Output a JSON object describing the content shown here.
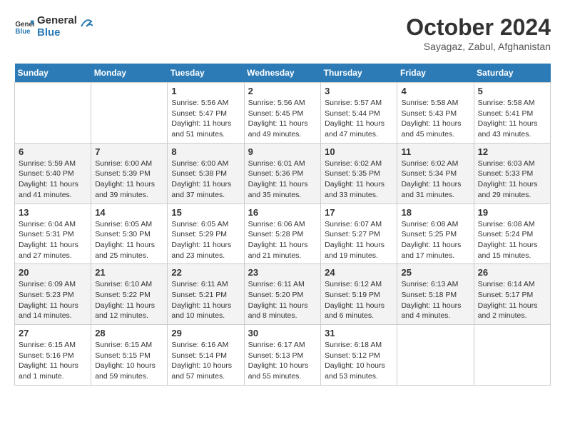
{
  "header": {
    "logo_line1": "General",
    "logo_line2": "Blue",
    "month_title": "October 2024",
    "location": "Sayagaz, Zabul, Afghanistan"
  },
  "days_of_week": [
    "Sunday",
    "Monday",
    "Tuesday",
    "Wednesday",
    "Thursday",
    "Friday",
    "Saturday"
  ],
  "weeks": [
    [
      {
        "day": "",
        "info": ""
      },
      {
        "day": "",
        "info": ""
      },
      {
        "day": "1",
        "info": "Sunrise: 5:56 AM\nSunset: 5:47 PM\nDaylight: 11 hours and 51 minutes."
      },
      {
        "day": "2",
        "info": "Sunrise: 5:56 AM\nSunset: 5:45 PM\nDaylight: 11 hours and 49 minutes."
      },
      {
        "day": "3",
        "info": "Sunrise: 5:57 AM\nSunset: 5:44 PM\nDaylight: 11 hours and 47 minutes."
      },
      {
        "day": "4",
        "info": "Sunrise: 5:58 AM\nSunset: 5:43 PM\nDaylight: 11 hours and 45 minutes."
      },
      {
        "day": "5",
        "info": "Sunrise: 5:58 AM\nSunset: 5:41 PM\nDaylight: 11 hours and 43 minutes."
      }
    ],
    [
      {
        "day": "6",
        "info": "Sunrise: 5:59 AM\nSunset: 5:40 PM\nDaylight: 11 hours and 41 minutes."
      },
      {
        "day": "7",
        "info": "Sunrise: 6:00 AM\nSunset: 5:39 PM\nDaylight: 11 hours and 39 minutes."
      },
      {
        "day": "8",
        "info": "Sunrise: 6:00 AM\nSunset: 5:38 PM\nDaylight: 11 hours and 37 minutes."
      },
      {
        "day": "9",
        "info": "Sunrise: 6:01 AM\nSunset: 5:36 PM\nDaylight: 11 hours and 35 minutes."
      },
      {
        "day": "10",
        "info": "Sunrise: 6:02 AM\nSunset: 5:35 PM\nDaylight: 11 hours and 33 minutes."
      },
      {
        "day": "11",
        "info": "Sunrise: 6:02 AM\nSunset: 5:34 PM\nDaylight: 11 hours and 31 minutes."
      },
      {
        "day": "12",
        "info": "Sunrise: 6:03 AM\nSunset: 5:33 PM\nDaylight: 11 hours and 29 minutes."
      }
    ],
    [
      {
        "day": "13",
        "info": "Sunrise: 6:04 AM\nSunset: 5:31 PM\nDaylight: 11 hours and 27 minutes."
      },
      {
        "day": "14",
        "info": "Sunrise: 6:05 AM\nSunset: 5:30 PM\nDaylight: 11 hours and 25 minutes."
      },
      {
        "day": "15",
        "info": "Sunrise: 6:05 AM\nSunset: 5:29 PM\nDaylight: 11 hours and 23 minutes."
      },
      {
        "day": "16",
        "info": "Sunrise: 6:06 AM\nSunset: 5:28 PM\nDaylight: 11 hours and 21 minutes."
      },
      {
        "day": "17",
        "info": "Sunrise: 6:07 AM\nSunset: 5:27 PM\nDaylight: 11 hours and 19 minutes."
      },
      {
        "day": "18",
        "info": "Sunrise: 6:08 AM\nSunset: 5:25 PM\nDaylight: 11 hours and 17 minutes."
      },
      {
        "day": "19",
        "info": "Sunrise: 6:08 AM\nSunset: 5:24 PM\nDaylight: 11 hours and 15 minutes."
      }
    ],
    [
      {
        "day": "20",
        "info": "Sunrise: 6:09 AM\nSunset: 5:23 PM\nDaylight: 11 hours and 14 minutes."
      },
      {
        "day": "21",
        "info": "Sunrise: 6:10 AM\nSunset: 5:22 PM\nDaylight: 11 hours and 12 minutes."
      },
      {
        "day": "22",
        "info": "Sunrise: 6:11 AM\nSunset: 5:21 PM\nDaylight: 11 hours and 10 minutes."
      },
      {
        "day": "23",
        "info": "Sunrise: 6:11 AM\nSunset: 5:20 PM\nDaylight: 11 hours and 8 minutes."
      },
      {
        "day": "24",
        "info": "Sunrise: 6:12 AM\nSunset: 5:19 PM\nDaylight: 11 hours and 6 minutes."
      },
      {
        "day": "25",
        "info": "Sunrise: 6:13 AM\nSunset: 5:18 PM\nDaylight: 11 hours and 4 minutes."
      },
      {
        "day": "26",
        "info": "Sunrise: 6:14 AM\nSunset: 5:17 PM\nDaylight: 11 hours and 2 minutes."
      }
    ],
    [
      {
        "day": "27",
        "info": "Sunrise: 6:15 AM\nSunset: 5:16 PM\nDaylight: 11 hours and 1 minute."
      },
      {
        "day": "28",
        "info": "Sunrise: 6:15 AM\nSunset: 5:15 PM\nDaylight: 10 hours and 59 minutes."
      },
      {
        "day": "29",
        "info": "Sunrise: 6:16 AM\nSunset: 5:14 PM\nDaylight: 10 hours and 57 minutes."
      },
      {
        "day": "30",
        "info": "Sunrise: 6:17 AM\nSunset: 5:13 PM\nDaylight: 10 hours and 55 minutes."
      },
      {
        "day": "31",
        "info": "Sunrise: 6:18 AM\nSunset: 5:12 PM\nDaylight: 10 hours and 53 minutes."
      },
      {
        "day": "",
        "info": ""
      },
      {
        "day": "",
        "info": ""
      }
    ]
  ]
}
